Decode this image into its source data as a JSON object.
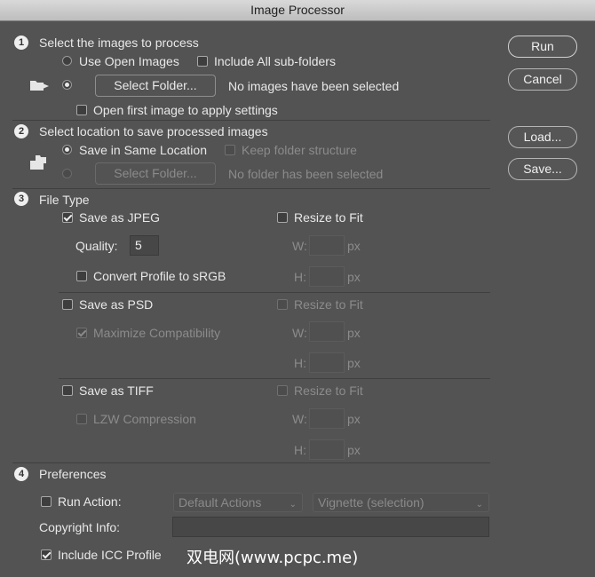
{
  "window": {
    "title": "Image Processor"
  },
  "side_buttons": {
    "run": "Run",
    "cancel": "Cancel",
    "load": "Load...",
    "save": "Save..."
  },
  "section1": {
    "number": "1",
    "title": "Select the images to process",
    "use_open_images": "Use Open Images",
    "include_subfolders": "Include All sub-folders",
    "select_folder": "Select Folder...",
    "status": "No images have been selected",
    "open_first": "Open first image to apply settings"
  },
  "section2": {
    "number": "2",
    "title": "Select location to save processed images",
    "save_same": "Save in Same Location",
    "keep_structure": "Keep folder structure",
    "select_folder": "Select Folder...",
    "status": "No folder has been selected"
  },
  "section3": {
    "number": "3",
    "title": "File Type",
    "jpeg": {
      "label": "Save as JPEG",
      "resize": "Resize to Fit",
      "quality_label": "Quality:",
      "quality_value": "5",
      "w": "W:",
      "h": "H:",
      "px": "px",
      "convert": "Convert Profile to sRGB"
    },
    "psd": {
      "label": "Save as PSD",
      "resize": "Resize to Fit",
      "maximize": "Maximize Compatibility",
      "w": "W:",
      "h": "H:",
      "px": "px"
    },
    "tiff": {
      "label": "Save as TIFF",
      "resize": "Resize to Fit",
      "lzw": "LZW Compression",
      "w": "W:",
      "h": "H:",
      "px": "px"
    }
  },
  "section4": {
    "number": "4",
    "title": "Preferences",
    "run_action": "Run Action:",
    "action_set": "Default Actions",
    "action": "Vignette (selection)",
    "copyright": "Copyright Info:",
    "icc": "Include ICC Profile"
  },
  "watermark": "双电网(www.pcpc.me)"
}
